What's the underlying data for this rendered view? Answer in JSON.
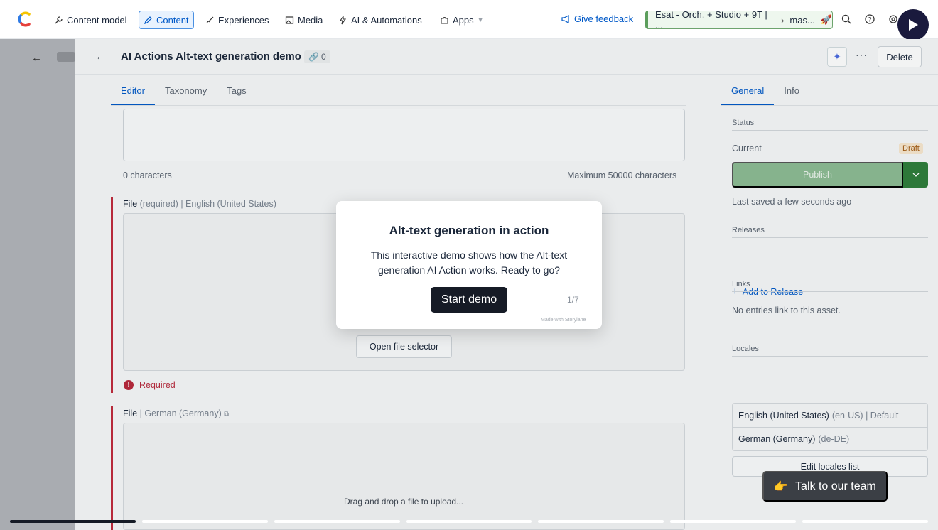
{
  "topnav": {
    "items": [
      {
        "label": "Content model",
        "icon": "wrench-icon"
      },
      {
        "label": "Content",
        "icon": "pencil-icon",
        "active": true
      },
      {
        "label": "Experiences",
        "icon": "brush-icon"
      },
      {
        "label": "Media",
        "icon": "image-icon"
      },
      {
        "label": "AI & Automations",
        "icon": "lightning-icon"
      },
      {
        "label": "Apps",
        "icon": "puzzle-icon"
      }
    ],
    "feedback": "Give feedback",
    "environment": "Esat - Orch. + Studio + 9T | ...",
    "environment_branch": "mas..."
  },
  "entry": {
    "title": "AI Actions Alt-text generation demo",
    "link_count": "0",
    "delete_label": "Delete"
  },
  "editor_tabs": [
    "Editor",
    "Taxonomy",
    "Tags"
  ],
  "text_field": {
    "char_count": "0 characters",
    "char_max": "Maximum 50000 characters"
  },
  "file_field_en": {
    "label": "File",
    "required": "(required)",
    "locale": "English (United States)",
    "open_button": "Open file selector",
    "error": "Required"
  },
  "file_field_de": {
    "label": "File",
    "locale": "German (Germany)",
    "drag_text": "Drag and drop a file to upload..."
  },
  "sidebar": {
    "tabs": [
      "General",
      "Info"
    ],
    "status_heading": "Status",
    "current_label": "Current",
    "status_badge": "Draft",
    "publish_label": "Publish",
    "last_saved": "Last saved a few seconds ago",
    "releases_heading": "Releases",
    "add_release": "Add to Release",
    "links_heading": "Links",
    "links_text": "No entries link to this asset.",
    "locales_heading": "Locales",
    "locales": [
      {
        "name": "English (United States)",
        "detail": "(en-US) | Default"
      },
      {
        "name": "German (Germany)",
        "detail": "(de-DE)"
      }
    ],
    "edit_locales": "Edit locales list"
  },
  "modal": {
    "title": "Alt-text generation in action",
    "body": "This interactive demo shows how the Alt-text generation AI Action works. Ready to go?",
    "start_label": "Start demo",
    "step": "1/7",
    "made_with": "Made with Storylane"
  },
  "talk_button": "Talk to our team",
  "progress": {
    "current_step": 1,
    "total_steps": 7
  },
  "colors": {
    "accent": "#0059c8",
    "publish": "#2e7d3a",
    "required": "#c0293b",
    "modal_button": "#161b26"
  }
}
